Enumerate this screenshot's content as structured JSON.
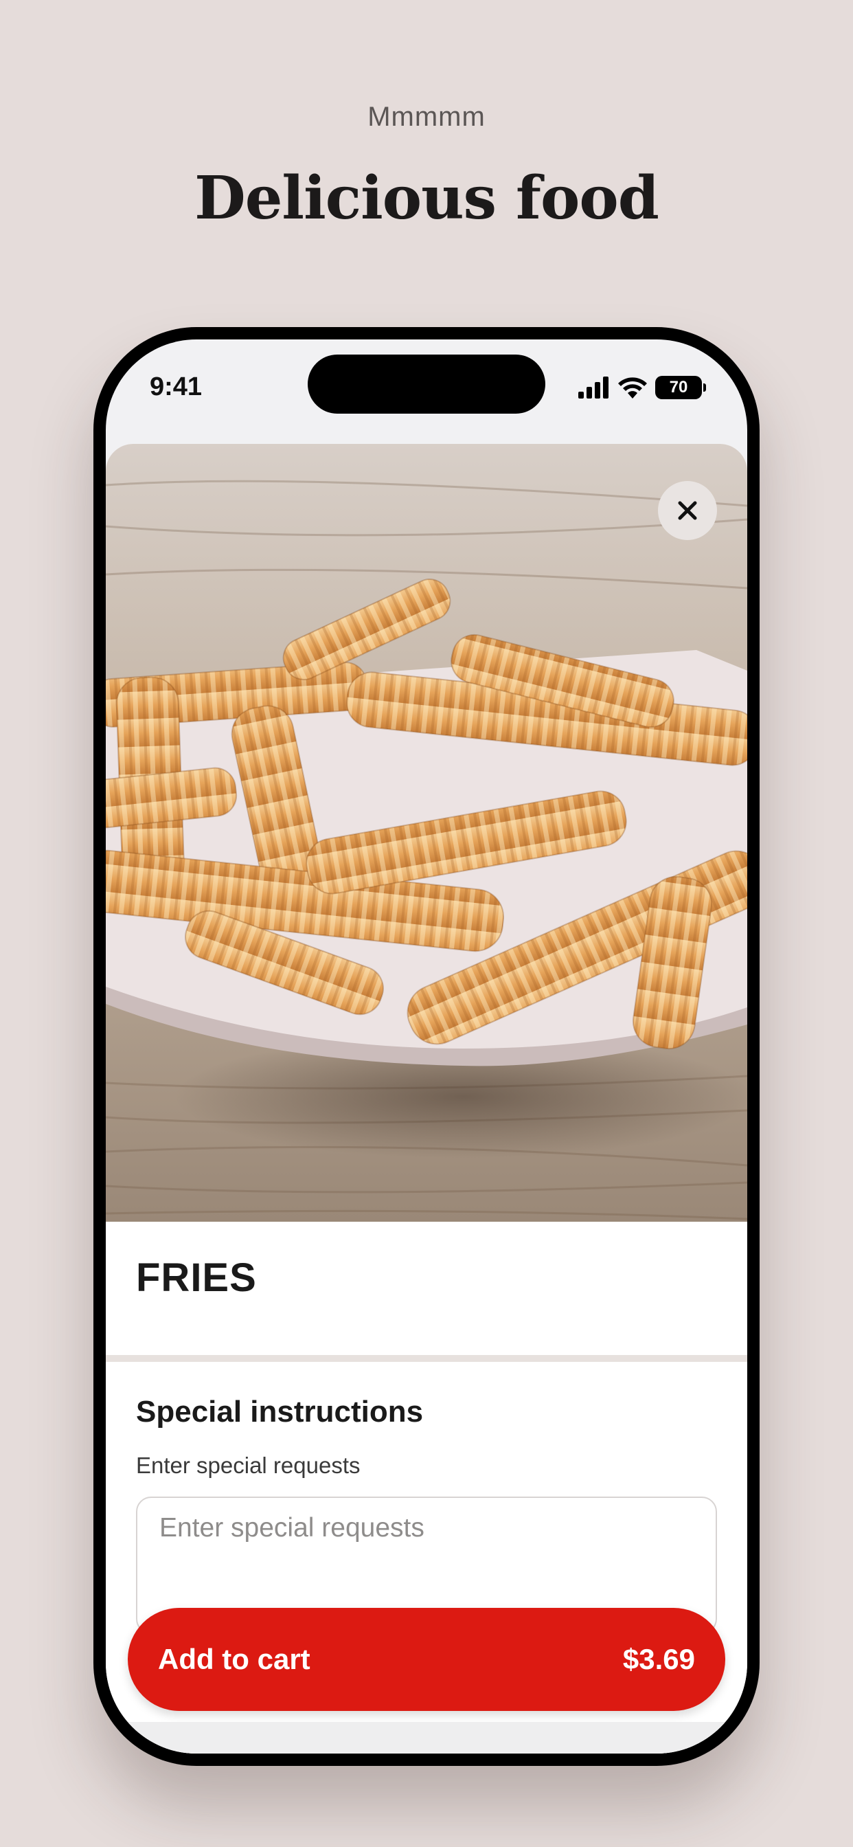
{
  "promo": {
    "kicker": "Mmmmm",
    "title": "Delicious food"
  },
  "status_bar": {
    "time": "9:41",
    "battery": "70",
    "icons": [
      "signal-icon",
      "wifi-icon",
      "battery-icon"
    ]
  },
  "item": {
    "photo_icon": "fries-photo",
    "close_icon": "close-icon",
    "name": "FRIES"
  },
  "special_instructions": {
    "title": "Special instructions",
    "subtitle": "Enter special requests",
    "placeholder": "Enter special requests",
    "value": ""
  },
  "cart_button": {
    "label": "Add to cart",
    "price": "$3.69"
  },
  "colors": {
    "background": "#e5dcda",
    "accent": "#dc1a12"
  }
}
